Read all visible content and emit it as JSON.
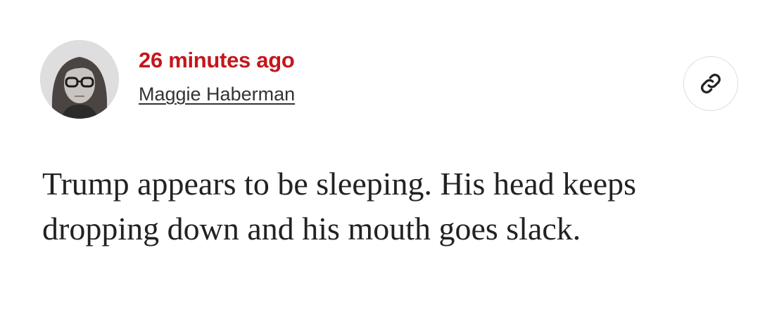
{
  "post": {
    "timestamp": "26 minutes ago",
    "author": "Maggie Haberman",
    "body": "Trump appears to be sleeping. His head keeps dropping down and his mouth goes slack."
  },
  "icons": {
    "avatar": "author-avatar-photo",
    "share": "link-icon"
  },
  "colors": {
    "timestamp": "#c4161c",
    "author": "#333333",
    "body": "#222222",
    "background": "#ffffff"
  }
}
